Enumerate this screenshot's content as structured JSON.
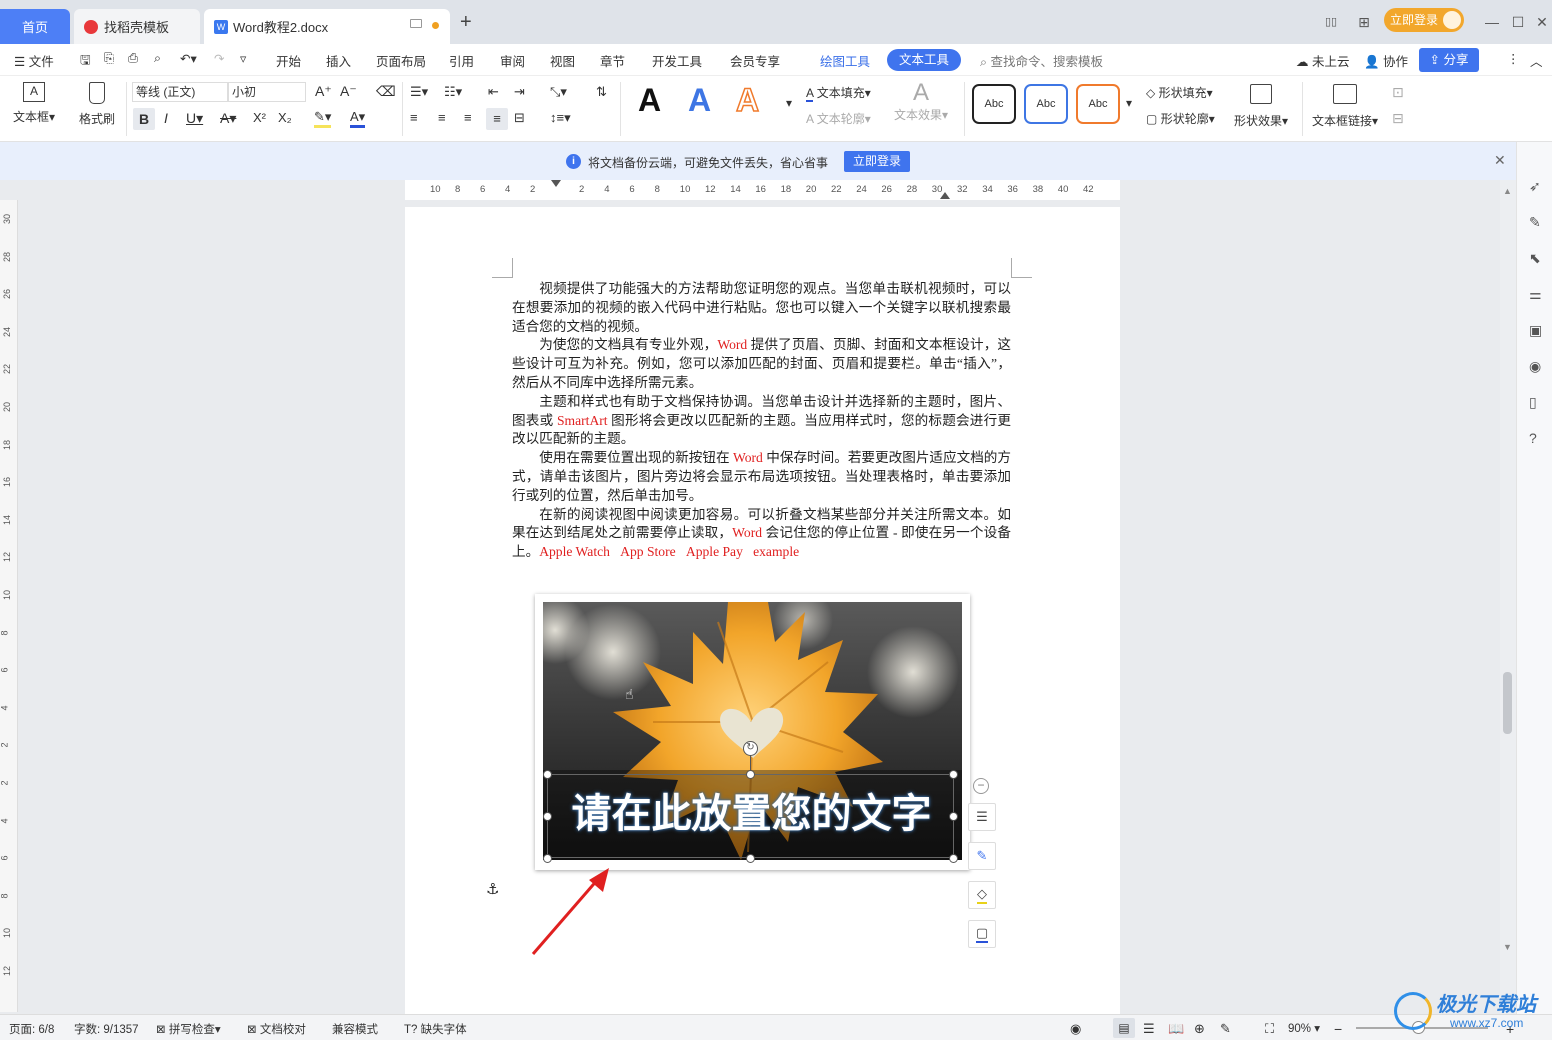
{
  "tabs": {
    "home": "首页",
    "template": "找稻壳模板",
    "doc": "Word教程2.docx"
  },
  "title_right": {
    "login": "立即登录"
  },
  "menu": {
    "file": "文件",
    "items": [
      "开始",
      "插入",
      "页面布局",
      "引用",
      "审阅",
      "视图",
      "章节",
      "开发工具",
      "会员专享"
    ],
    "draw_tools": "绘图工具",
    "text_tools": "文本工具",
    "search_placeholder": "查找命令、搜索模板",
    "cloud": "未上云",
    "collab": "协作",
    "share": "分享"
  },
  "ribbon": {
    "textbox": "文本框",
    "format_painter": "格式刷",
    "font": "等线 (正文)",
    "size": "小初",
    "text_fill": "文本填充",
    "text_outline": "文本轮廓",
    "text_effect": "文本效果",
    "style_abc": "Abc",
    "shape_fill": "形状填充",
    "shape_outline": "形状轮廓",
    "shape_effect": "形状效果",
    "textbox_link": "文本框链接"
  },
  "notice": {
    "text": "将文档备份云端，可避免文件丢失，省心省事",
    "button": "立即登录"
  },
  "ruler_h": [
    "10",
    "8",
    "6",
    "4",
    "2",
    "2",
    "4",
    "6",
    "8",
    "10",
    "12",
    "14",
    "16",
    "18",
    "20",
    "22",
    "24",
    "26",
    "28",
    "30",
    "32",
    "34",
    "36",
    "38",
    "40",
    "42"
  ],
  "ruler_v": [
    "30",
    "28",
    "26",
    "24",
    "22",
    "20",
    "18",
    "16",
    "14",
    "12",
    "10",
    "8",
    "6",
    "4",
    "2",
    "2",
    "4",
    "6",
    "8",
    "10",
    "12"
  ],
  "document": {
    "p1": "视频提供了功能强大的方法帮助您证明您的观点。当您单击联机视频时，可以在想要添加的视频的嵌入代码中进行粘贴。您也可以键入一个关键字以联机搜索最适合您的文档的视频。",
    "p2a": "为使您的文档具有专业外观，",
    "p2b": "Word",
    "p2c": " 提供了页眉、页脚、封面和文本框设计，这些设计可互为补充。例如，您可以添加匹配的封面、页眉和提要栏。单击“插入”，然后从不同库中选择所需元素。",
    "p3a": "主题和样式也有助于文档保持协调。当您单击设计并选择新的主题时，图片、图表或 ",
    "p3b": "SmartArt",
    "p3c": " 图形将会更改以匹配新的主题。当应用样式时，您的标题会进行更改以匹配新的主题。",
    "p4a": "使用在需要位置出现的新按钮在 ",
    "p4b": "Word",
    "p4c": " 中保存时间。若要更改图片适应文档的方式，请单击该图片，图片旁边将会显示布局选项按钮。当处理表格时，单击要添加行或列的位置，然后单击加号。",
    "p5a": "在新的阅读视图中阅读更加容易。可以折叠文档某些部分并关注所需文本。如果在达到结尾处之前需要停止读取，",
    "p5b": "Word",
    "p5c": " 会记住您的停止位置 - 即使在另一个设备上。",
    "p5d": "Apple Watch",
    "p5e": "App Store",
    "p5f": "Apple Pay",
    "p5g": "example",
    "caption": "请在此放置您的文字"
  },
  "status": {
    "page": "页面: 6/8",
    "words": "字数: 9/1357",
    "spell": "拼写检查",
    "proof": "文档校对",
    "compat": "兼容模式",
    "missing_font": "缺失字体",
    "zoom": "90%"
  },
  "watermark": {
    "name": "极光下载站",
    "url": "www.xz7.com"
  },
  "colors": {
    "accent": "#4d7ff6",
    "login": "#f2a72c",
    "red_text": "#e02020"
  }
}
